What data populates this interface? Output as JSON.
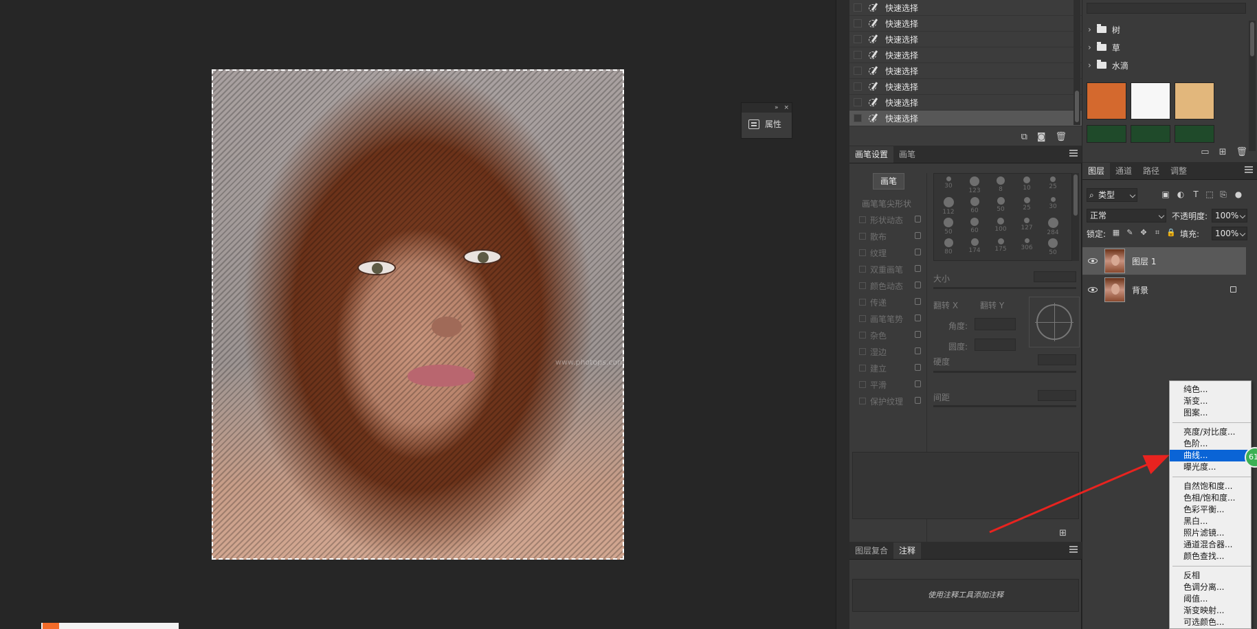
{
  "properties_panel": {
    "label": "属性",
    "collapse_glyph": "»",
    "close_glyph": "×"
  },
  "history": {
    "items": [
      "快速选择",
      "快速选择",
      "快速选择",
      "快速选择",
      "快速选择",
      "快速选择",
      "快速选择",
      "快速选择"
    ]
  },
  "brush_panel": {
    "tabs": [
      "画笔设置",
      "画笔"
    ],
    "brush_button": "画笔",
    "tip_shape_header": "画笔笔尖形状",
    "options": [
      "形状动态",
      "散布",
      "纹理",
      "双重画笔",
      "颜色动态",
      "传递",
      "画笔笔势",
      "杂色",
      "湿边",
      "建立",
      "平滑",
      "保护纹理"
    ],
    "tip_sizes": [
      "30",
      "123",
      "8",
      "10",
      "25",
      "112",
      "60",
      "50",
      "25",
      "30",
      "50",
      "60",
      "100",
      "127",
      "284",
      "80",
      "174",
      "175",
      "306",
      "50"
    ],
    "size_label": "大小",
    "flip_x": "翻转 X",
    "flip_y": "翻转 Y",
    "angle_label": "角度:",
    "roundness_label": "圆度:",
    "hardness_label": "硬度",
    "spacing_label": "间距"
  },
  "notes_panel": {
    "tabs": [
      "图层复合",
      "注释"
    ],
    "placeholder": "使用注释工具添加注释"
  },
  "libraries": {
    "folders": [
      "树",
      "草",
      "水滴"
    ],
    "swatch_colors": [
      "#d4692e",
      "#f7f7f7",
      "#e2b77c",
      "#1f4a2a",
      "#1f4a2a",
      "#1f4a2a"
    ]
  },
  "layers_panel": {
    "tabs": [
      "图层",
      "通道",
      "路径",
      "调整"
    ],
    "filter_kind": "类型",
    "blend_mode": "正常",
    "opacity_label": "不透明度:",
    "opacity_value": "100%",
    "lock_label": "锁定:",
    "fill_label": "填充:",
    "fill_value": "100%",
    "layers": [
      {
        "name": "图层 1",
        "selected": true,
        "locked": false
      },
      {
        "name": "背景",
        "selected": false,
        "locked": true
      }
    ]
  },
  "adjustment_menu": {
    "groups": [
      [
        "纯色...",
        "渐变...",
        "图案..."
      ],
      [
        "亮度/对比度...",
        "色阶...",
        "曲线...",
        "曝光度..."
      ],
      [
        "自然饱和度...",
        "色相/饱和度...",
        "色彩平衡...",
        "黑白...",
        "照片滤镜...",
        "通道混合器...",
        "颜色查找..."
      ],
      [
        "反相",
        "色调分离...",
        "阈值...",
        "渐变映射...",
        "可选颜色..."
      ]
    ],
    "highlighted": "曲线..."
  },
  "badge": {
    "text": "61"
  },
  "watermark": "www.photops.com",
  "colors": {
    "highlight": "#0a64d6",
    "arrow": "#e8231f",
    "badge": "#3cb054"
  }
}
